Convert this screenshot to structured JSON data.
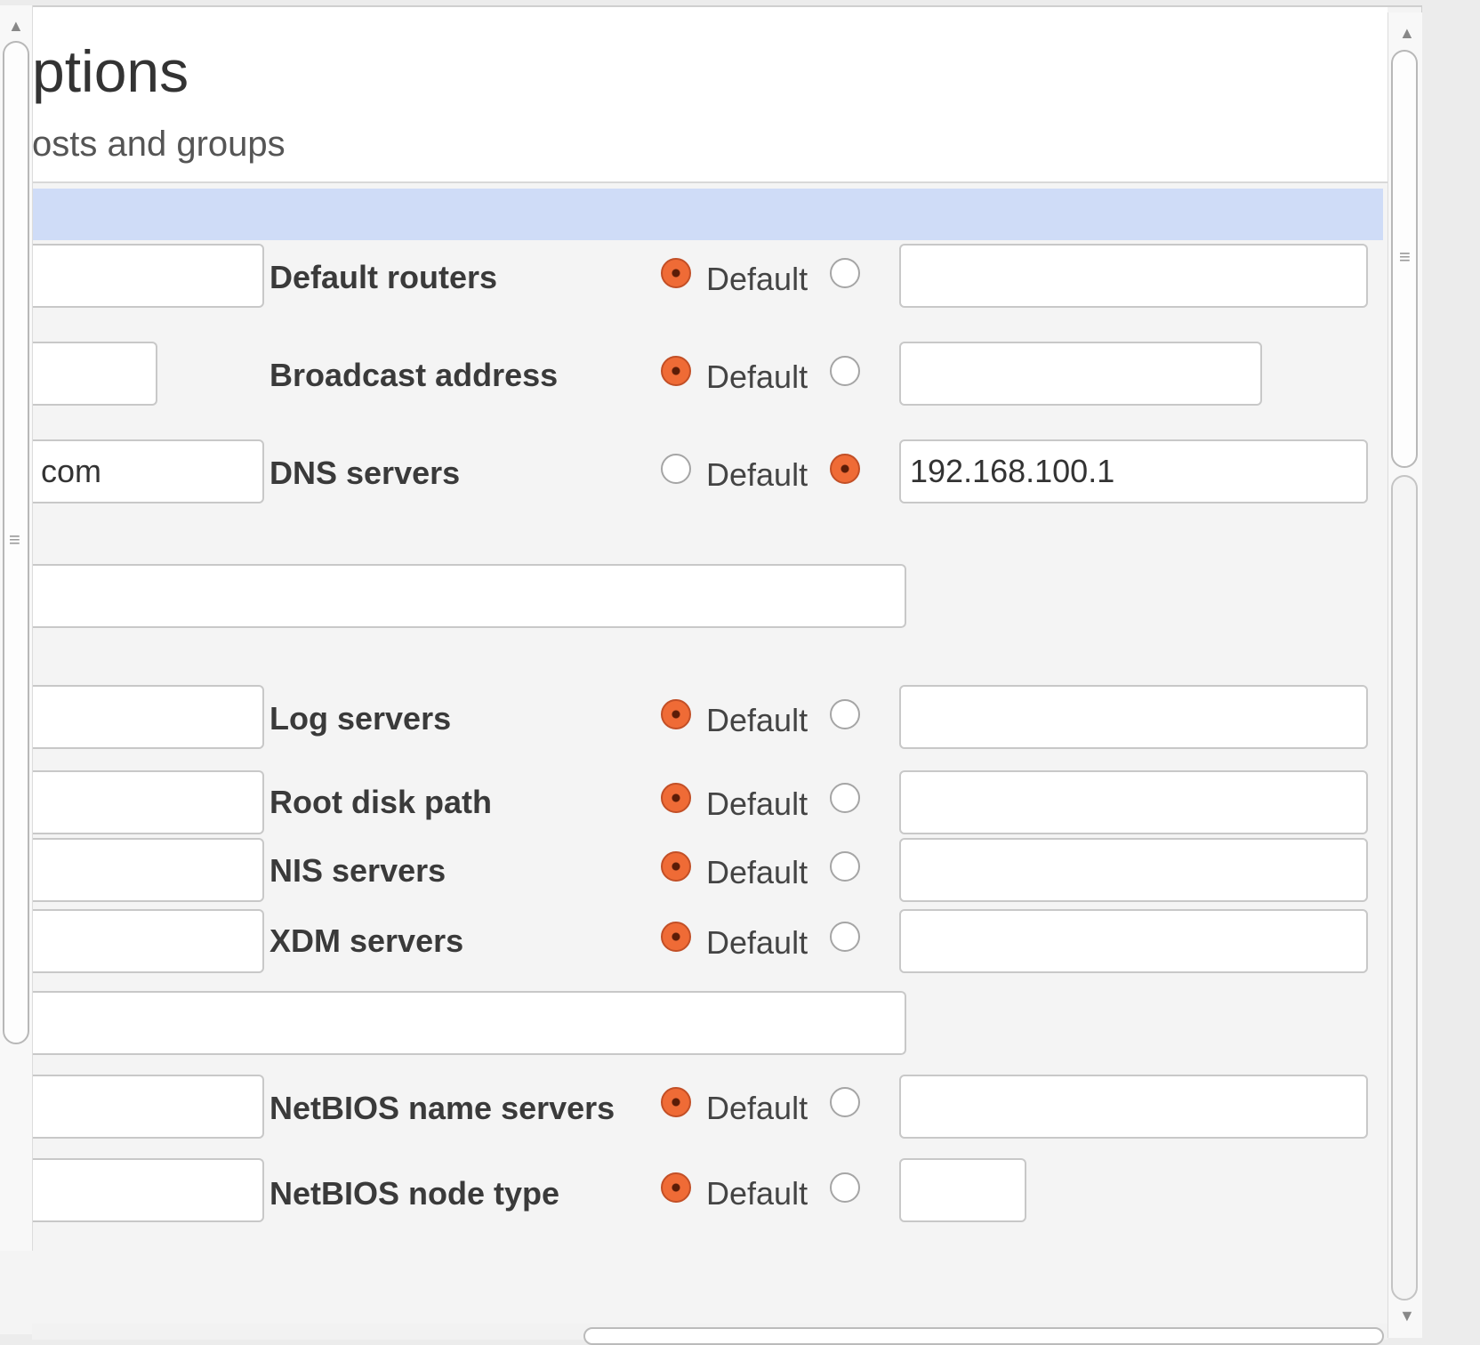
{
  "page": {
    "title": "ptions",
    "subtitle": "osts and groups"
  },
  "options": {
    "default_label": "Default",
    "rows": [
      {
        "label": "Default routers",
        "default_selected": true,
        "value": ""
      },
      {
        "label": "Broadcast address",
        "default_selected": true,
        "value": ""
      },
      {
        "label": "DNS servers",
        "default_selected": false,
        "value": "192.168.100.1"
      },
      {
        "label": "Log servers",
        "default_selected": true,
        "value": ""
      },
      {
        "label": "Root disk path",
        "default_selected": true,
        "value": ""
      },
      {
        "label": "NIS servers",
        "default_selected": true,
        "value": ""
      },
      {
        "label": "XDM servers",
        "default_selected": true,
        "value": ""
      },
      {
        "label": "NetBIOS name servers",
        "default_selected": true,
        "value": ""
      },
      {
        "label": "NetBIOS node type",
        "default_selected": true,
        "value": ""
      }
    ]
  },
  "left_fields": {
    "domain_name_value": "com"
  },
  "colors": {
    "section_bar": "#cfdcf7",
    "radio_selected": "#ef6b36",
    "panel_background": "#f4f4f4"
  }
}
